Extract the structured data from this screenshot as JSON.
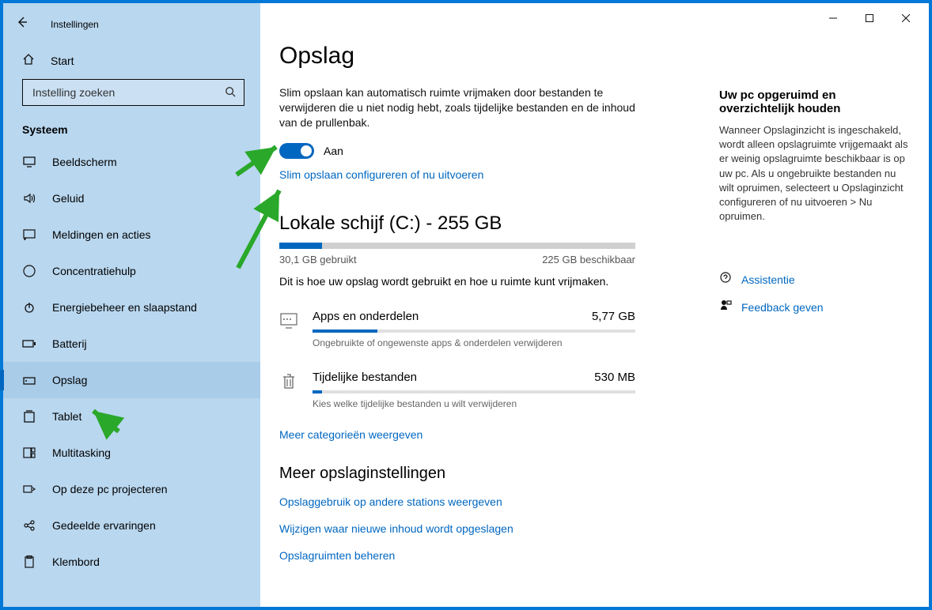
{
  "window": {
    "app_title": "Instellingen"
  },
  "sidebar": {
    "home": "Start",
    "search_placeholder": "Instelling zoeken",
    "group": "Systeem",
    "items": [
      {
        "icon": "display-icon",
        "label": "Beeldscherm"
      },
      {
        "icon": "sound-icon",
        "label": "Geluid"
      },
      {
        "icon": "notifications-icon",
        "label": "Meldingen en acties"
      },
      {
        "icon": "focus-assist-icon",
        "label": "Concentratiehulp"
      },
      {
        "icon": "power-icon",
        "label": "Energiebeheer en slaapstand"
      },
      {
        "icon": "battery-icon",
        "label": "Batterij"
      },
      {
        "icon": "storage-icon",
        "label": "Opslag",
        "selected": true
      },
      {
        "icon": "tablet-icon",
        "label": "Tablet"
      },
      {
        "icon": "multitasking-icon",
        "label": "Multitasking"
      },
      {
        "icon": "project-icon",
        "label": "Op deze pc projecteren"
      },
      {
        "icon": "shared-icon",
        "label": "Gedeelde ervaringen"
      },
      {
        "icon": "clipboard-icon",
        "label": "Klembord"
      }
    ]
  },
  "main": {
    "page_title": "Opslag",
    "intro": "Slim opslaan kan automatisch ruimte vrijmaken door bestanden te verwijderen die u niet nodig hebt, zoals tijdelijke bestanden en de inhoud van de prullenbak.",
    "toggle_state": "Aan",
    "configure_link": "Slim opslaan configureren of nu uitvoeren",
    "disk": {
      "title": "Lokale schijf (C:) - 255 GB",
      "used_label": "30,1 GB gebruikt",
      "free_label": "225 GB beschikbaar",
      "used_percent": 12,
      "description": "Dit is hoe uw opslag wordt gebruikt en hoe u ruimte kunt vrijmaken."
    },
    "categories": [
      {
        "icon": "apps-icon",
        "name": "Apps en onderdelen",
        "size": "5,77 GB",
        "fill_percent": 20,
        "hint": "Ongebruikte of ongewenste apps & onderdelen verwijderen"
      },
      {
        "icon": "trash-icon",
        "name": "Tijdelijke bestanden",
        "size": "530 MB",
        "fill_percent": 3,
        "hint": "Kies welke tijdelijke bestanden u wilt verwijderen"
      }
    ],
    "more_categories": "Meer categorieën weergeven",
    "more_settings_heading": "Meer opslaginstellingen",
    "more_links": [
      "Opslaggebruik op andere stations weergeven",
      "Wijzigen waar nieuwe inhoud wordt opgeslagen",
      "Opslagruimten beheren"
    ]
  },
  "right": {
    "title": "Uw pc opgeruimd en overzichtelijk houden",
    "body": "Wanneer Opslaginzicht is ingeschakeld, wordt alleen opslagruimte vrijgemaakt als er weinig opslagruimte beschikbaar is op uw pc. Als u ongebruikte bestanden nu wilt opruimen, selecteert u Opslaginzicht configureren of nu uitvoeren > Nu opruimen.",
    "help": [
      {
        "icon": "assist-icon",
        "label": "Assistentie"
      },
      {
        "icon": "feedback-icon",
        "label": "Feedback geven"
      }
    ]
  },
  "annotations": {
    "arrow_color": "#2aa82a"
  }
}
